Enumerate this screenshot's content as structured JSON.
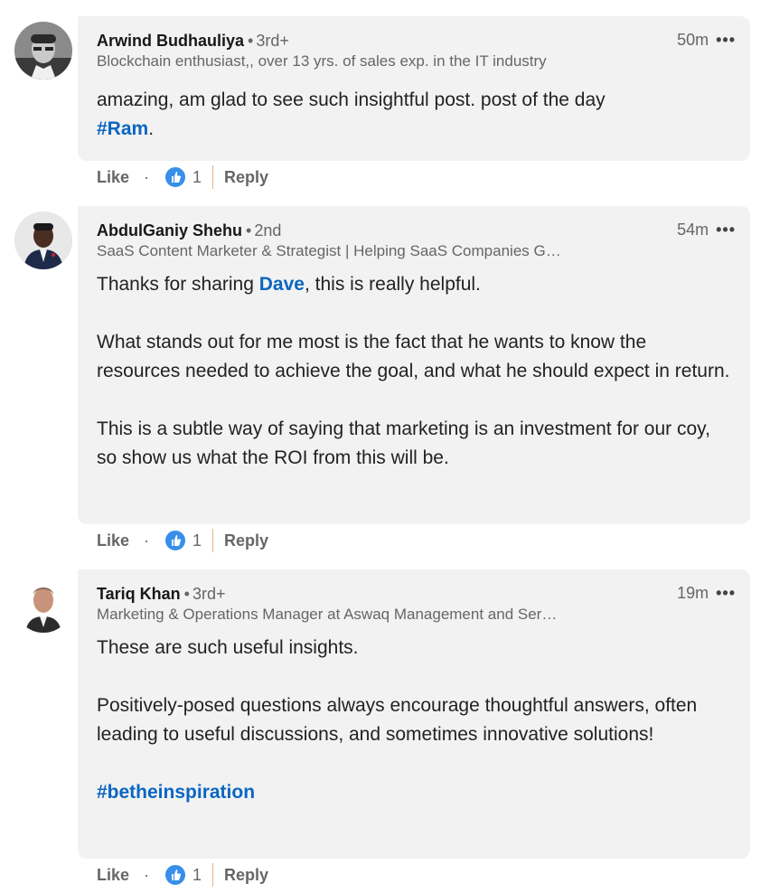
{
  "comments": [
    {
      "name": "Arwind Budhauliya",
      "degree": "3rd+",
      "headline": "Blockchain enthusiast,, over 13 yrs. of sales exp. in the IT industry",
      "time": "50m",
      "more": "•••",
      "body_text": "amazing, am glad to see such insightful post. post of the day",
      "mention": "#Ram",
      "after_mention": ".",
      "like_label": "Like",
      "like_count": "1",
      "reply_label": "Reply"
    },
    {
      "name": "AbdulGaniy Shehu",
      "degree": "2nd",
      "headline": "SaaS Content Marketer & Strategist | Helping SaaS Companies G…",
      "time": "54m",
      "more": "•••",
      "p1_before": "Thanks for sharing ",
      "p1_mention": "Dave",
      "p1_after": ", this is really helpful.",
      "p2": "What stands out for me most is the fact that he wants to know the resources needed to achieve the goal, and what he should expect in return.",
      "p3": "This is a subtle way of saying that marketing is an investment for our coy, so show us what the ROI from this will be.",
      "like_label": "Like",
      "like_count": "1",
      "reply_label": "Reply"
    },
    {
      "name": "Tariq Khan",
      "degree": "3rd+",
      "headline": "Marketing & Operations Manager at Aswaq Management and Ser…",
      "time": "19m",
      "more": "•••",
      "p1": "These are such useful insights.",
      "p2": "Positively-posed questions always encourage thoughtful answers, often leading to useful discussions, and sometimes innovative solutions!",
      "hashtag": "#betheinspiration",
      "like_label": "Like",
      "like_count": "1",
      "reply_label": "Reply"
    }
  ],
  "colors": {
    "bubble": "#f2f2f2",
    "link": "#0a66c2",
    "muted": "#666666",
    "like": "#378fe9"
  },
  "separator": "·"
}
